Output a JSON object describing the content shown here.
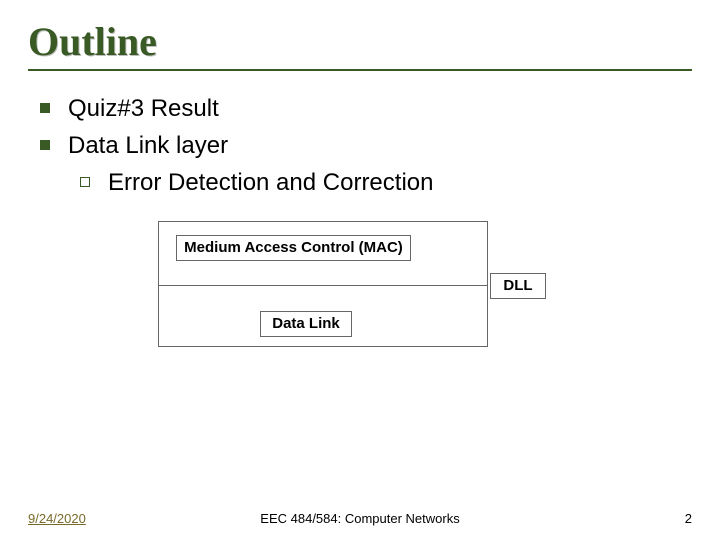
{
  "title": "Outline",
  "bullets": {
    "item0": "Quiz#3 Result",
    "item1": "Data Link layer",
    "sub10": "Error Detection and Correction"
  },
  "diagram": {
    "mac": "Medium Access Control (MAC)",
    "dll": "DLL",
    "datalink": "Data Link"
  },
  "footer": {
    "date": "9/24/2020",
    "center": "EEC 484/584: Computer Networks",
    "page": "2"
  }
}
